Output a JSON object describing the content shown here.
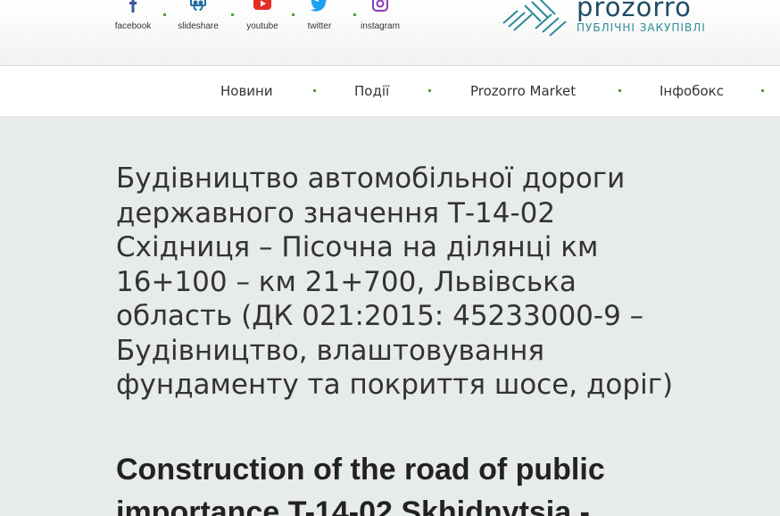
{
  "social": [
    {
      "label": "facebook",
      "icon": "facebook-icon",
      "color": "#3b5998"
    },
    {
      "label": "slideshare",
      "icon": "slideshare-icon",
      "color": "#1d6fa5"
    },
    {
      "label": "youtube",
      "icon": "youtube-icon",
      "color": "#e52d27"
    },
    {
      "label": "twitter",
      "icon": "twitter-icon",
      "color": "#1da1f2"
    },
    {
      "label": "instagram",
      "icon": "instagram-icon",
      "color": "#8a3ab9"
    }
  ],
  "logo": {
    "name": "prozorro",
    "tagline": "ПУБЛІЧНІ ЗАКУПІВЛІ",
    "brand_color": "#1d4d66",
    "accent_color": "#2d8a99"
  },
  "nav": [
    {
      "label": "Новини"
    },
    {
      "label": "Події"
    },
    {
      "label": "Prozorro Market"
    },
    {
      "label": "Інфобокс"
    }
  ],
  "article": {
    "title_uk": "Будівництво автомобільної дороги державного значення Т-14-02 Східниця – Пісочна на ділянці км 16+100 – км 21+700, Львівська область (ДК 021:2015: 45233000-9 – Будівництво, влаштовування фундаменту та покриття шосе, доріг)",
    "title_en": "Construction of the road of public importance T-14-02 Skhidnytsia -"
  }
}
